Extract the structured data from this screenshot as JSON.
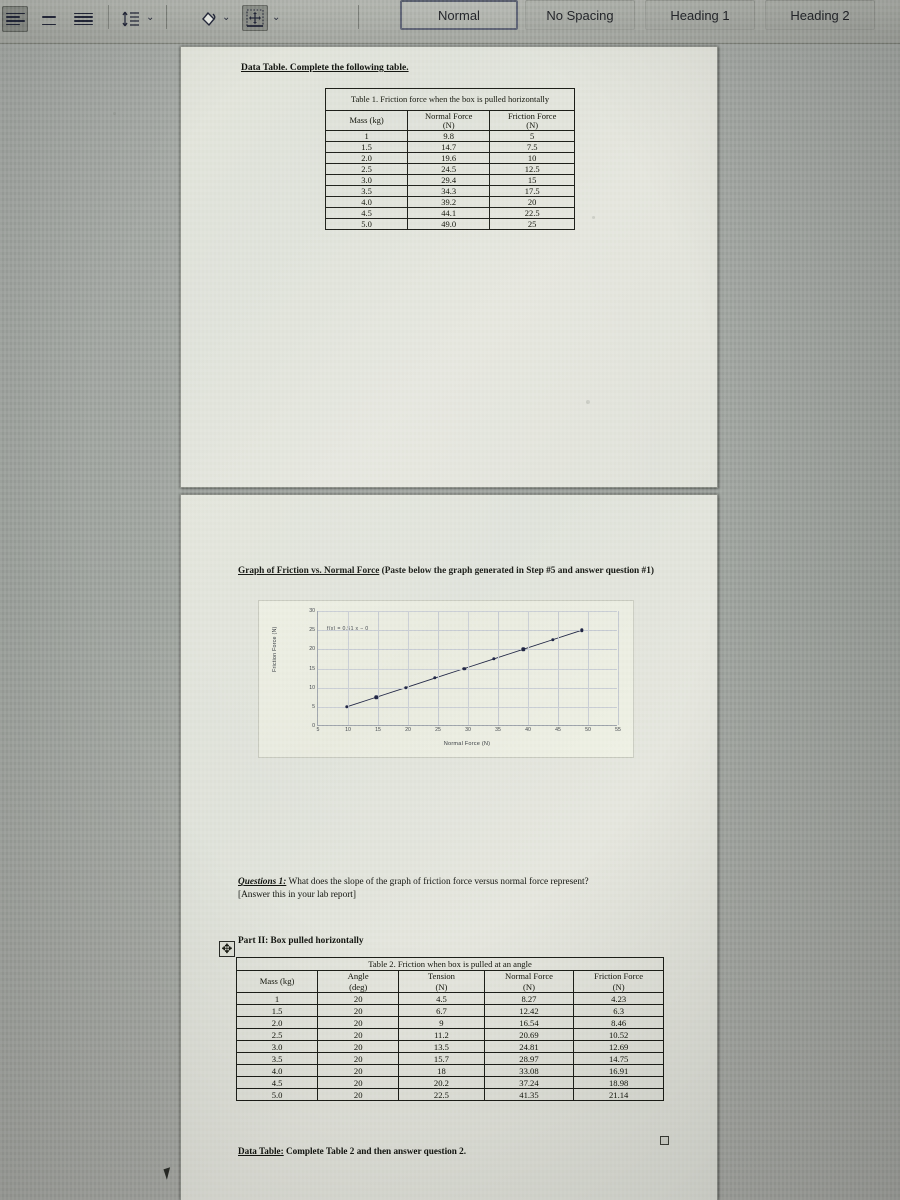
{
  "ribbon": {
    "align_icons": [
      {
        "name": "align-left-icon",
        "selected": true
      },
      {
        "name": "align-center-icon",
        "selected": false
      },
      {
        "name": "align-justify-icon",
        "selected": false
      }
    ],
    "line_spacing": {
      "name": "line-spacing-icon",
      "chevron": "⌄"
    },
    "shading": {
      "name": "shading-paint-bucket-icon",
      "chevron": "⌄"
    },
    "borders": {
      "name": "borders-icon",
      "chevron": "⌄",
      "selected": true
    },
    "styles": [
      {
        "label": "Normal",
        "active": true
      },
      {
        "label": "No Spacing",
        "active": false
      },
      {
        "label": "Heading 1",
        "active": false
      },
      {
        "label": "Heading 2",
        "active": false
      }
    ]
  },
  "page1": {
    "heading": "Data Table. Complete the following table.",
    "table1": {
      "title": "Table 1. Friction force when the box is pulled horizontally",
      "columns": [
        "Mass (kg)",
        "Normal Force (N)",
        "Friction Force (N)"
      ],
      "rows": [
        [
          "1",
          "9.8",
          "5"
        ],
        [
          "1.5",
          "14.7",
          "7.5"
        ],
        [
          "2.0",
          "19.6",
          "10"
        ],
        [
          "2.5",
          "24.5",
          "12.5"
        ],
        [
          "3.0",
          "29.4",
          "15"
        ],
        [
          "3.5",
          "34.3",
          "17.5"
        ],
        [
          "4.0",
          "39.2",
          "20"
        ],
        [
          "4.5",
          "44.1",
          "22.5"
        ],
        [
          "5.0",
          "49.0",
          "25"
        ]
      ]
    }
  },
  "page2": {
    "graph_heading_underlined": "Graph of Friction vs. Normal Force",
    "graph_heading_rest": " (Paste below the graph generated in Step #5 and answer question #1)",
    "question_label": "Questions 1:",
    "question_text": " What does the slope of the graph of friction force versus normal force represent?",
    "question_note": "[Answer this in your lab report]",
    "part2_heading": "Part II: Box pulled horizontally",
    "footer_label": "Data Table:",
    "footer_text": " Complete Table 2 and then answer question 2.",
    "table2": {
      "title": "Table 2. Friction when box is pulled at an angle",
      "columns": [
        "Mass (kg)",
        "Angle (deg)",
        "Tension (N)",
        "Normal Force (N)",
        "Friction Force (N)"
      ],
      "rows": [
        [
          "1",
          "20",
          "4.5",
          "8.27",
          "4.23"
        ],
        [
          "1.5",
          "20",
          "6.7",
          "12.42",
          "6.3"
        ],
        [
          "2.0",
          "20",
          "9",
          "16.54",
          "8.46"
        ],
        [
          "2.5",
          "20",
          "11.2",
          "20.69",
          "10.52"
        ],
        [
          "3.0",
          "20",
          "13.5",
          "24.81",
          "12.69"
        ],
        [
          "3.5",
          "20",
          "15.7",
          "28.97",
          "14.75"
        ],
        [
          "4.0",
          "20",
          "18",
          "33.08",
          "16.91"
        ],
        [
          "4.5",
          "20",
          "20.2",
          "37.24",
          "18.98"
        ],
        [
          "5.0",
          "20",
          "22.5",
          "41.35",
          "21.14"
        ]
      ]
    }
  },
  "handles": {
    "table_move_handle": "✥",
    "table_resize_handle": ""
  },
  "chart_data": {
    "type": "scatter",
    "title": "",
    "xlabel": "Normal Force (N)",
    "ylabel": "Friction Force (N)",
    "annotation": "f(x) = 0.51 x − 0",
    "xlim": [
      5,
      55
    ],
    "ylim": [
      0,
      30
    ],
    "xticks": [
      5,
      10,
      15,
      20,
      25,
      30,
      35,
      40,
      45,
      50,
      55
    ],
    "yticks": [
      0,
      5,
      10,
      15,
      20,
      25,
      30
    ],
    "grid": true,
    "legend": "none",
    "trendline": {
      "slope": 0.51,
      "intercept": 0
    },
    "x": [
      9.8,
      14.7,
      19.6,
      24.5,
      29.4,
      34.3,
      39.2,
      44.1,
      49.0
    ],
    "y": [
      5,
      7.5,
      10,
      12.5,
      15,
      17.5,
      20,
      22.5,
      25
    ],
    "series": [
      {
        "name": "Friction Force (N)",
        "x": [
          9.8,
          14.7,
          19.6,
          24.5,
          29.4,
          34.3,
          39.2,
          44.1,
          49.0
        ],
        "values": [
          5,
          7.5,
          10,
          12.5,
          15,
          17.5,
          20,
          22.5,
          25
        ]
      }
    ]
  },
  "colors": {
    "page": "#e3e5dc",
    "ribbon": "#a9aca6",
    "ink": "#12140f",
    "chart_marker": "#1a2040",
    "chart_grid": "#c6cbd2"
  }
}
